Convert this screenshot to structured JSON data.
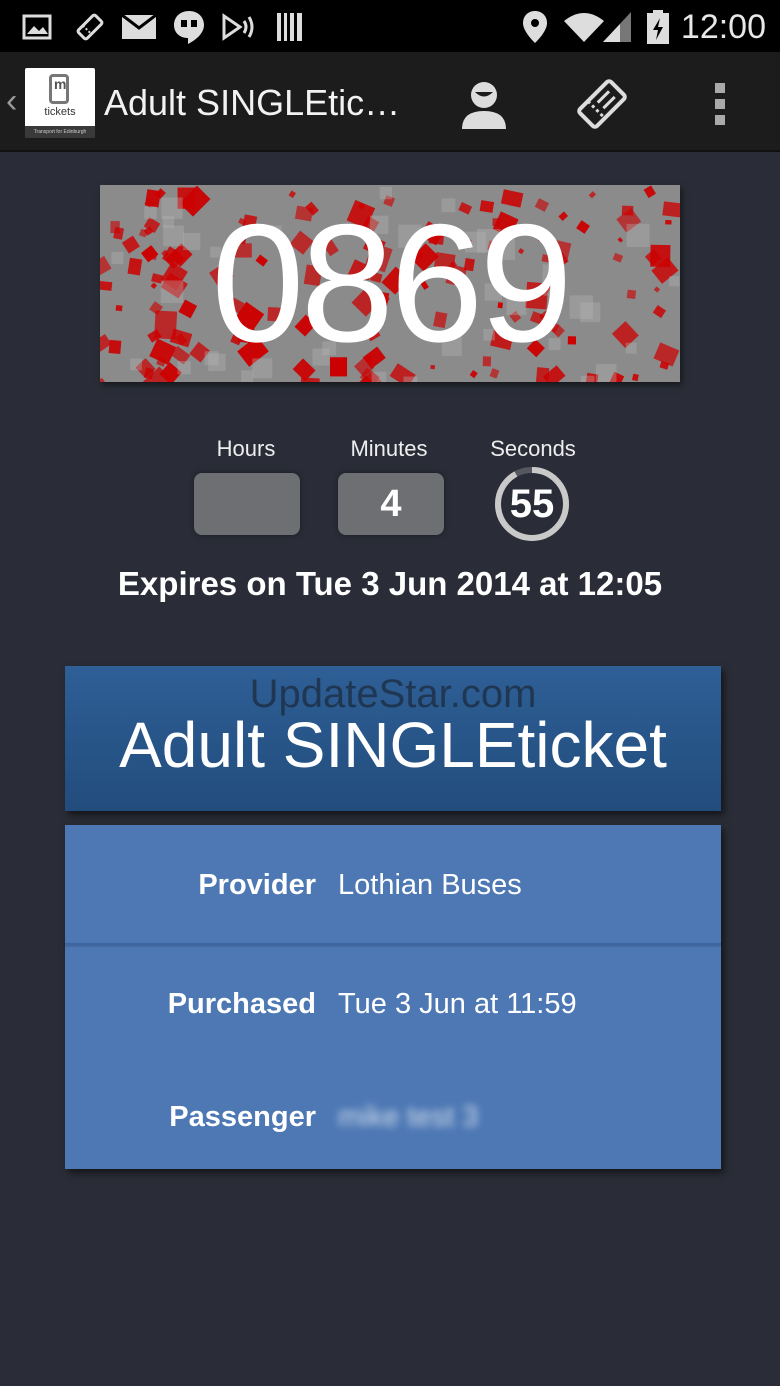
{
  "status_bar": {
    "time": "12:00",
    "icons": [
      "gallery-icon",
      "ticket-notification-icon",
      "mail-icon",
      "hangouts-icon",
      "cast-icon",
      "barcode-icon",
      "location-icon",
      "wifi-icon",
      "cell-signal-icon",
      "battery-charging-icon"
    ]
  },
  "action_bar": {
    "title": "Adult SINGLEtic…",
    "logo_text": "tickets",
    "logo_letter": "m",
    "logo_subtext": "Transport for Edinburgh",
    "actions": [
      "account-icon",
      "tickets-icon",
      "overflow-menu-icon"
    ]
  },
  "ticket_code": "0869",
  "countdown": {
    "hours_label": "Hours",
    "minutes_label": "Minutes",
    "seconds_label": "Seconds",
    "hours_value": "",
    "minutes_value": "4",
    "seconds_value": "55",
    "seconds_progress": 0.92
  },
  "expires_text": "Expires on Tue 3 Jun 2014 at 12:05",
  "ticket": {
    "watermark": "UpdateStar.com",
    "name": "Adult SINGLEticket",
    "rows": [
      {
        "label": "Provider",
        "value": "Lothian Buses"
      },
      {
        "label": "Purchased",
        "value": "Tue 3 Jun at 11:59"
      },
      {
        "label": "Passenger",
        "value": "mike test 3"
      }
    ]
  },
  "colors": {
    "background": "#2a2d37",
    "header_blue": "#2a5a90",
    "details_blue": "#4d78b4",
    "code_accent_red": "#cc0000"
  }
}
